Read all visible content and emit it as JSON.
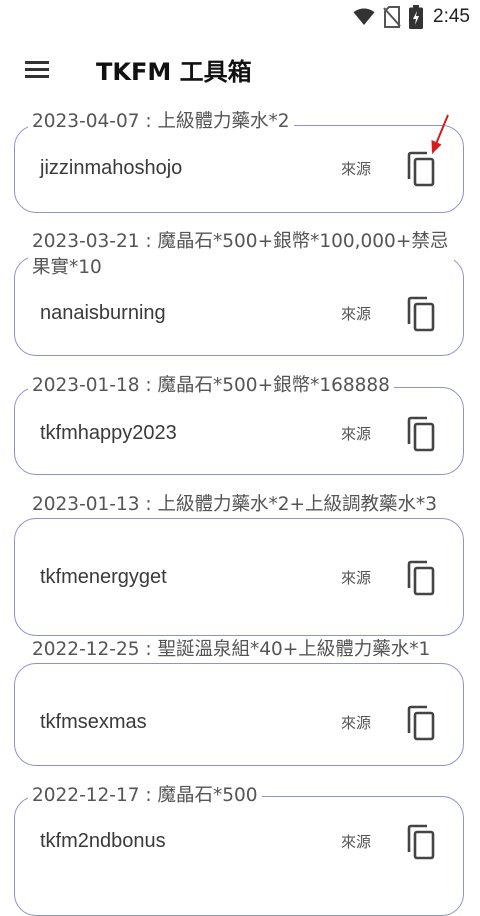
{
  "status_bar": {
    "time": "2:45",
    "icons": [
      "wifi-icon",
      "no-sim-icon",
      "battery-charging-icon"
    ]
  },
  "app_bar": {
    "title": "TKFM 工具箱",
    "menu_icon": "hamburger-menu-icon"
  },
  "source_label": "來源",
  "copy_icon": "copy-icon",
  "accent_color": "#8f92c7",
  "annotation_color": "#d81b1b",
  "codes": [
    {
      "title": "2023-04-07 : 上級體力藥水*2",
      "code": "jizzinmahoshojo"
    },
    {
      "title": "2023-03-21 : 魔晶石*500+銀幣*100,000+禁忌果實*10",
      "code": "nanaisburning"
    },
    {
      "title": "2023-01-18 : 魔晶石*500+銀幣*168888",
      "code": "tkfmhappy2023"
    },
    {
      "title": "2023-01-13 : 上級體力藥水*2+上級調教藥水*3",
      "code": "tkfmenergyget"
    },
    {
      "title": "2022-12-25 : 聖誕溫泉組*40+上級體力藥水*1",
      "code": "tkfmsexmas"
    },
    {
      "title": "2022-12-17 : 魔晶石*500",
      "code": "tkfm2ndbonus"
    }
  ]
}
